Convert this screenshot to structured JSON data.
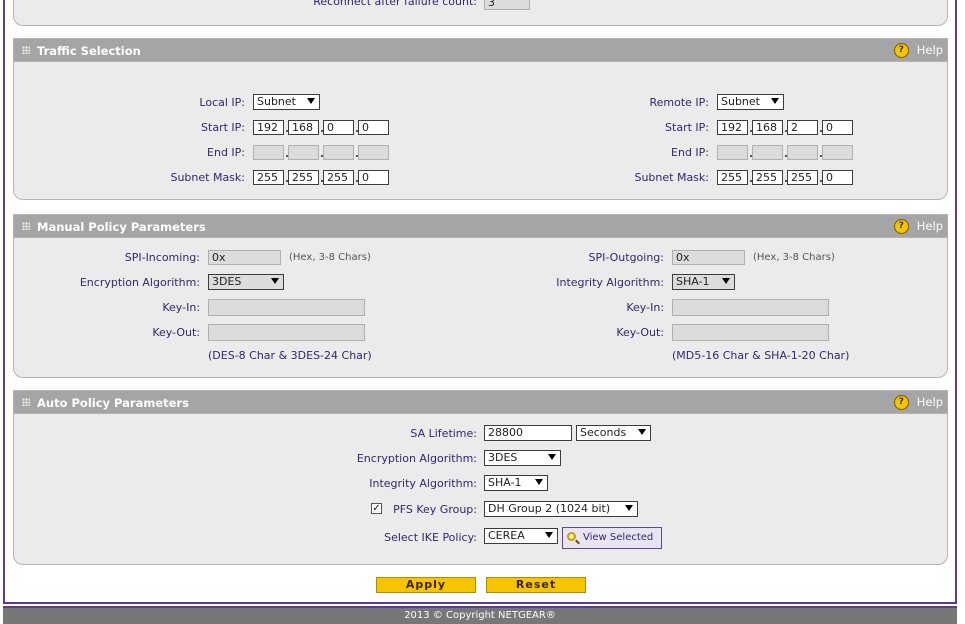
{
  "top": {
    "reconnect_label": "Reconnect after failure count:",
    "reconnect_value": "3"
  },
  "traffic": {
    "title": "Traffic Selection",
    "help": "Help",
    "local": {
      "ip_label": "Local IP:",
      "ip_type": "Subnet",
      "start_label": "Start IP:",
      "start": [
        "192",
        "168",
        "0",
        "0"
      ],
      "end_label": "End IP:",
      "end": [
        "",
        "",
        "",
        ""
      ],
      "mask_label": "Subnet Mask:",
      "mask": [
        "255",
        "255",
        "255",
        "0"
      ]
    },
    "remote": {
      "ip_label": "Remote IP:",
      "ip_type": "Subnet",
      "start_label": "Start IP:",
      "start": [
        "192",
        "168",
        "2",
        "0"
      ],
      "end_label": "End IP:",
      "end": [
        "",
        "",
        "",
        ""
      ],
      "mask_label": "Subnet Mask:",
      "mask": [
        "255",
        "255",
        "255",
        "0"
      ]
    }
  },
  "manual": {
    "title": "Manual Policy Parameters",
    "help": "Help",
    "spi_in_label": "SPI-Incoming:",
    "spi_in_value": "0x",
    "spi_in_hint": "(Hex, 3-8 Chars)",
    "enc_label": "Encryption Algorithm:",
    "enc_value": "3DES",
    "keyin_label": "Key-In:",
    "keyout_label": "Key-Out:",
    "enc_note": "(DES-8 Char & 3DES-24 Char)",
    "spi_out_label": "SPI-Outgoing:",
    "spi_out_value": "0x",
    "spi_out_hint": "(Hex, 3-8 Chars)",
    "int_label": "Integrity Algorithm:",
    "int_value": "SHA-1",
    "keyin2_label": "Key-In:",
    "keyout2_label": "Key-Out:",
    "int_note": "(MD5-16 Char & SHA-1-20 Char)"
  },
  "auto": {
    "title": "Auto Policy Parameters",
    "help": "Help",
    "sa_label": "SA Lifetime:",
    "sa_value": "28800",
    "sa_unit": "Seconds",
    "enc_label": "Encryption Algorithm:",
    "enc_value": "3DES",
    "int_label": "Integrity Algorithm:",
    "int_value": "SHA-1",
    "pfs_label": "PFS Key Group:",
    "pfs_checked": "✓",
    "pfs_value": "DH Group 2 (1024 bit)",
    "ike_label": "Select IKE Policy:",
    "ike_value": "CEREA",
    "view_label": "View Selected"
  },
  "buttons": {
    "apply": "Apply",
    "reset": "Reset"
  },
  "footer": {
    "copyright": "2013 © Copyright NETGEAR®"
  }
}
